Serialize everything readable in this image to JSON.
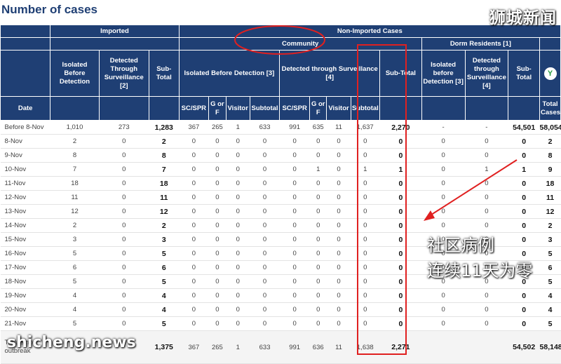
{
  "title": "Number of cases",
  "headers": {
    "imported": "Imported",
    "non_imported": "Non-Imported Cases",
    "community": "Community",
    "dorm_residents": "Dorm Residents [1]",
    "imported_isolated": "Isolated Before Detection",
    "imported_surveillance": "Detected Through Surveillance [2]",
    "imported_subtotal": "Sub-Total",
    "isolated_before_detection": "Isolated Before Detection [3]",
    "detected_through_surveillance": "Detected through Surveillance [4]",
    "community_subtotal": "Sub-Total",
    "dorm_isolated": "Isolated before Detection [3]",
    "dorm_surveillance": "Detected through Surveillance [4]",
    "dorm_subtotal": "Sub-Total",
    "logo_icon": "Y",
    "date": "Date",
    "total_cases": "Total Cases",
    "sc_spr": "SC/SPR",
    "g_or_f": "G or F",
    "visitor": "Visitor",
    "subtotal": "Subtotal"
  },
  "rows": [
    {
      "date": "Before 8-Nov",
      "imp_iso": "1,010",
      "imp_surv": "273",
      "imp_sub": "1,283",
      "ib_sc": "367",
      "ib_gf": "265",
      "ib_vis": "1",
      "ib_sub": "633",
      "ds_sc": "991",
      "ds_gf": "635",
      "ds_vis": "11",
      "ds_sub": "1,637",
      "comm_sub": "2,270",
      "dorm_iso": "-",
      "dorm_surv": "-",
      "dorm_sub": "54,501",
      "total": "58,054"
    },
    {
      "date": "8-Nov",
      "imp_iso": "2",
      "imp_surv": "0",
      "imp_sub": "2",
      "ib_sc": "0",
      "ib_gf": "0",
      "ib_vis": "0",
      "ib_sub": "0",
      "ds_sc": "0",
      "ds_gf": "0",
      "ds_vis": "0",
      "ds_sub": "0",
      "comm_sub": "0",
      "dorm_iso": "0",
      "dorm_surv": "0",
      "dorm_sub": "0",
      "total": "2"
    },
    {
      "date": "9-Nov",
      "imp_iso": "8",
      "imp_surv": "0",
      "imp_sub": "8",
      "ib_sc": "0",
      "ib_gf": "0",
      "ib_vis": "0",
      "ib_sub": "0",
      "ds_sc": "0",
      "ds_gf": "0",
      "ds_vis": "0",
      "ds_sub": "0",
      "comm_sub": "0",
      "dorm_iso": "0",
      "dorm_surv": "0",
      "dorm_sub": "0",
      "total": "8"
    },
    {
      "date": "10-Nov",
      "imp_iso": "7",
      "imp_surv": "0",
      "imp_sub": "7",
      "ib_sc": "0",
      "ib_gf": "0",
      "ib_vis": "0",
      "ib_sub": "0",
      "ds_sc": "0",
      "ds_gf": "1",
      "ds_vis": "0",
      "ds_sub": "1",
      "comm_sub": "1",
      "dorm_iso": "0",
      "dorm_surv": "1",
      "dorm_sub": "1",
      "total": "9"
    },
    {
      "date": "11-Nov",
      "imp_iso": "18",
      "imp_surv": "0",
      "imp_sub": "18",
      "ib_sc": "0",
      "ib_gf": "0",
      "ib_vis": "0",
      "ib_sub": "0",
      "ds_sc": "0",
      "ds_gf": "0",
      "ds_vis": "0",
      "ds_sub": "0",
      "comm_sub": "0",
      "dorm_iso": "0",
      "dorm_surv": "0",
      "dorm_sub": "0",
      "total": "18"
    },
    {
      "date": "12-Nov",
      "imp_iso": "11",
      "imp_surv": "0",
      "imp_sub": "11",
      "ib_sc": "0",
      "ib_gf": "0",
      "ib_vis": "0",
      "ib_sub": "0",
      "ds_sc": "0",
      "ds_gf": "0",
      "ds_vis": "0",
      "ds_sub": "0",
      "comm_sub": "0",
      "dorm_iso": "0",
      "dorm_surv": "0",
      "dorm_sub": "0",
      "total": "11"
    },
    {
      "date": "13-Nov",
      "imp_iso": "12",
      "imp_surv": "0",
      "imp_sub": "12",
      "ib_sc": "0",
      "ib_gf": "0",
      "ib_vis": "0",
      "ib_sub": "0",
      "ds_sc": "0",
      "ds_gf": "0",
      "ds_vis": "0",
      "ds_sub": "0",
      "comm_sub": "0",
      "dorm_iso": "0",
      "dorm_surv": "0",
      "dorm_sub": "0",
      "total": "12"
    },
    {
      "date": "14-Nov",
      "imp_iso": "2",
      "imp_surv": "0",
      "imp_sub": "2",
      "ib_sc": "0",
      "ib_gf": "0",
      "ib_vis": "0",
      "ib_sub": "0",
      "ds_sc": "0",
      "ds_gf": "0",
      "ds_vis": "0",
      "ds_sub": "0",
      "comm_sub": "0",
      "dorm_iso": "0",
      "dorm_surv": "0",
      "dorm_sub": "0",
      "total": "2"
    },
    {
      "date": "15-Nov",
      "imp_iso": "3",
      "imp_surv": "0",
      "imp_sub": "3",
      "ib_sc": "0",
      "ib_gf": "0",
      "ib_vis": "0",
      "ib_sub": "0",
      "ds_sc": "0",
      "ds_gf": "0",
      "ds_vis": "0",
      "ds_sub": "0",
      "comm_sub": "0",
      "dorm_iso": "0",
      "dorm_surv": "0",
      "dorm_sub": "0",
      "total": "3"
    },
    {
      "date": "16-Nov",
      "imp_iso": "5",
      "imp_surv": "0",
      "imp_sub": "5",
      "ib_sc": "0",
      "ib_gf": "0",
      "ib_vis": "0",
      "ib_sub": "0",
      "ds_sc": "0",
      "ds_gf": "0",
      "ds_vis": "0",
      "ds_sub": "0",
      "comm_sub": "0",
      "dorm_iso": "0",
      "dorm_surv": "0",
      "dorm_sub": "0",
      "total": "5"
    },
    {
      "date": "17-Nov",
      "imp_iso": "6",
      "imp_surv": "0",
      "imp_sub": "6",
      "ib_sc": "0",
      "ib_gf": "0",
      "ib_vis": "0",
      "ib_sub": "0",
      "ds_sc": "0",
      "ds_gf": "0",
      "ds_vis": "0",
      "ds_sub": "0",
      "comm_sub": "0",
      "dorm_iso": "0",
      "dorm_surv": "0",
      "dorm_sub": "0",
      "total": "6"
    },
    {
      "date": "18-Nov",
      "imp_iso": "5",
      "imp_surv": "0",
      "imp_sub": "5",
      "ib_sc": "0",
      "ib_gf": "0",
      "ib_vis": "0",
      "ib_sub": "0",
      "ds_sc": "0",
      "ds_gf": "0",
      "ds_vis": "0",
      "ds_sub": "0",
      "comm_sub": "0",
      "dorm_iso": "0",
      "dorm_surv": "0",
      "dorm_sub": "0",
      "total": "5"
    },
    {
      "date": "19-Nov",
      "imp_iso": "4",
      "imp_surv": "0",
      "imp_sub": "4",
      "ib_sc": "0",
      "ib_gf": "0",
      "ib_vis": "0",
      "ib_sub": "0",
      "ds_sc": "0",
      "ds_gf": "0",
      "ds_vis": "0",
      "ds_sub": "0",
      "comm_sub": "0",
      "dorm_iso": "0",
      "dorm_surv": "0",
      "dorm_sub": "0",
      "total": "4"
    },
    {
      "date": "20-Nov",
      "imp_iso": "4",
      "imp_surv": "0",
      "imp_sub": "4",
      "ib_sc": "0",
      "ib_gf": "0",
      "ib_vis": "0",
      "ib_sub": "0",
      "ds_sc": "0",
      "ds_gf": "0",
      "ds_vis": "0",
      "ds_sub": "0",
      "comm_sub": "0",
      "dorm_iso": "0",
      "dorm_surv": "0",
      "dorm_sub": "0",
      "total": "4"
    },
    {
      "date": "21-Nov",
      "imp_iso": "5",
      "imp_surv": "0",
      "imp_sub": "5",
      "ib_sc": "0",
      "ib_gf": "0",
      "ib_vis": "0",
      "ib_sub": "0",
      "ds_sc": "0",
      "ds_gf": "0",
      "ds_vis": "0",
      "ds_sub": "0",
      "comm_sub": "0",
      "dorm_iso": "0",
      "dorm_surv": "0",
      "dorm_sub": "0",
      "total": "5"
    }
  ],
  "total_row": {
    "date": "Total since outbreak",
    "imp_iso": "",
    "imp_surv": "",
    "imp_sub": "1,375",
    "ib_sc": "367",
    "ib_gf": "265",
    "ib_vis": "1",
    "ib_sub": "633",
    "ds_sc": "991",
    "ds_gf": "636",
    "ds_vis": "11",
    "ds_sub": "1,638",
    "comm_sub": "2,271",
    "dorm_iso": "",
    "dorm_surv": "",
    "dorm_sub": "54,502",
    "total": "58,148"
  },
  "overlays": {
    "watermark_top": "狮城新闻",
    "watermark_bottom": "shicheng.news",
    "annotation_line1": "社区病例",
    "annotation_line2": "连续11天为零",
    "highlight_color": "#e02020"
  }
}
